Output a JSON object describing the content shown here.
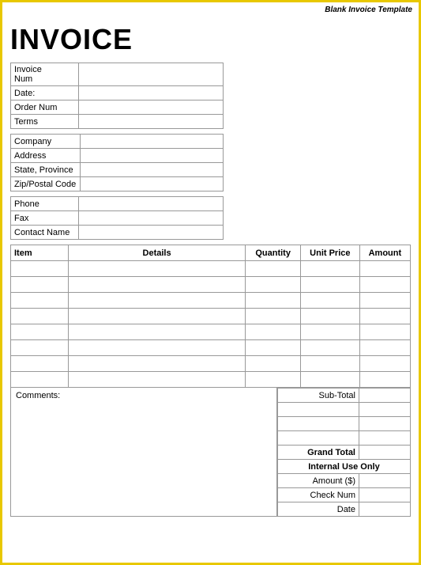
{
  "template": {
    "label": "Blank Invoice Template"
  },
  "header": {
    "title": "INVOICE"
  },
  "info_section1": {
    "fields": [
      {
        "label": "Invoice Num",
        "value": ""
      },
      {
        "label": "Date:",
        "value": ""
      },
      {
        "label": "Order Num",
        "value": ""
      },
      {
        "label": "Terms",
        "value": ""
      }
    ]
  },
  "info_section2": {
    "fields": [
      {
        "label": "Company",
        "value": ""
      },
      {
        "label": "Address",
        "value": ""
      },
      {
        "label": "State, Province",
        "value": ""
      },
      {
        "label": "Zip/Postal Code",
        "value": ""
      }
    ]
  },
  "info_section3": {
    "fields": [
      {
        "label": "Phone",
        "value": ""
      },
      {
        "label": "Fax",
        "value": ""
      },
      {
        "label": "Contact Name",
        "value": ""
      }
    ]
  },
  "items_table": {
    "headers": [
      "Item",
      "Details",
      "Quantity",
      "Unit Price",
      "Amount"
    ],
    "rows": 8
  },
  "comments": {
    "label": "Comments:"
  },
  "totals": {
    "subtotal_label": "Sub-Total",
    "rows_blank": 3,
    "grand_total_label": "Grand Total",
    "internal_use_label": "Internal Use Only",
    "fields": [
      {
        "label": "Amount ($)",
        "value": ""
      },
      {
        "label": "Check Num",
        "value": ""
      },
      {
        "label": "Date",
        "value": ""
      }
    ]
  }
}
